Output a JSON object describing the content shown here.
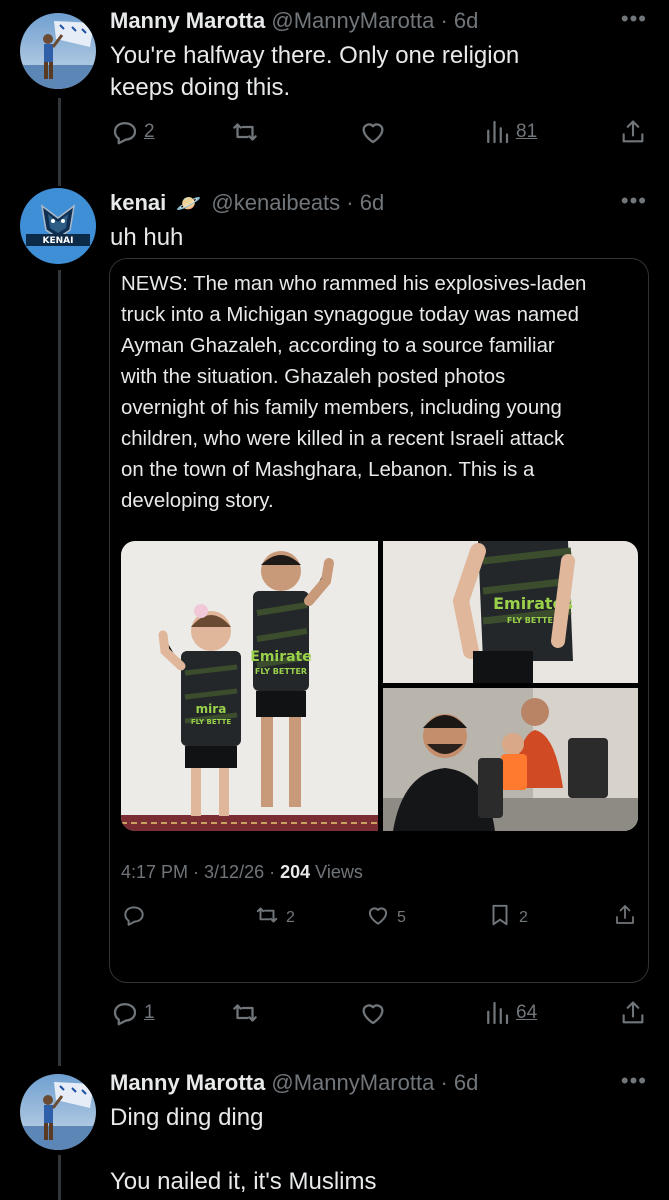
{
  "tweets": [
    {
      "name": "Manny Marotta",
      "handle": "@MannyMarotta",
      "time": "· 6d",
      "lines": [
        "You're halfway there. Only one religion",
        "keeps doing this."
      ],
      "replies": "2",
      "retweets": "",
      "likes": "",
      "views": "81"
    },
    {
      "name": "kenai",
      "badge_emoji": "🪐",
      "handle": "@kenaibeats",
      "time": "· 6d",
      "lines": [
        "uh huh"
      ],
      "replies": "1",
      "retweets": "",
      "likes": "",
      "views": "64",
      "avatar_text": "KENAI"
    },
    {
      "name": "Manny Marotta",
      "handle": "@MannyMarotta",
      "time": "· 6d",
      "lines": [
        "Ding ding ding",
        "",
        "You nailed it, it's Muslims"
      ]
    }
  ],
  "quote": {
    "lines": [
      "NEWS: The man who rammed his explosives-laden",
      "truck into a Michigan synagogue today was named",
      "Ayman Ghazaleh, according to a source familiar",
      "with the situation. Ghazaleh posted photos",
      "overnight of his family members, including young",
      "children, who were killed in a recent Israeli attack",
      "on the town of Mashghara, Lebanon. This is a",
      "developing story."
    ],
    "photo_texts": {
      "jersey_big": "Emirate",
      "jersey_big_sub": "FLY BETTER",
      "jersey_small": "mira",
      "jersey_small_sub": "FLY BETTE",
      "jersey_top": "Emirates",
      "jersey_top_sub": "FLY BETTER"
    },
    "time_date": "4:17 PM · 3/12/26 · ",
    "views_count": "204",
    "views_label": " Views",
    "replies": "",
    "retweets": "2",
    "likes": "5",
    "bookmarks": "2"
  },
  "icons": [
    "reply-icon",
    "retweet-icon",
    "like-icon",
    "views-icon",
    "share-icon",
    "bookmark-icon",
    "more-icon"
  ],
  "colors": {
    "background": "#000000",
    "text": "#e7e9ea",
    "muted": "#71767b",
    "border": "#2f3336",
    "jersey_green": "#9ad14b"
  }
}
